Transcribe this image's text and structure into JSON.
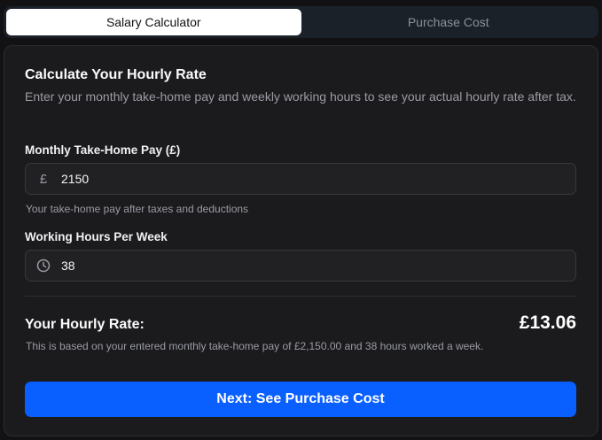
{
  "tabs": [
    {
      "label": "Salary Calculator",
      "active": true
    },
    {
      "label": "Purchase Cost",
      "active": false
    }
  ],
  "card": {
    "heading": "Calculate Your Hourly Rate",
    "description": "Enter your monthly take-home pay and weekly working hours to see your actual hourly rate after tax."
  },
  "pay_field": {
    "label": "Monthly Take-Home Pay (£)",
    "icon": "pound-icon",
    "icon_glyph": "£",
    "value": "2150",
    "hint": "Your take-home pay after taxes and deductions"
  },
  "hours_field": {
    "label": "Working Hours Per Week",
    "icon": "clock-icon",
    "value": "38"
  },
  "result": {
    "label": "Your Hourly Rate:",
    "value": "£13.06",
    "note": "This is based on your entered monthly take-home pay of £2,150.00 and 38 hours worked a week."
  },
  "next_button": {
    "label": "Next: See Purchase Cost"
  },
  "colors": {
    "accent": "#0a5fff",
    "background": "#121214",
    "card": "#1b1b1e",
    "tab_bar": "#1b2129"
  }
}
